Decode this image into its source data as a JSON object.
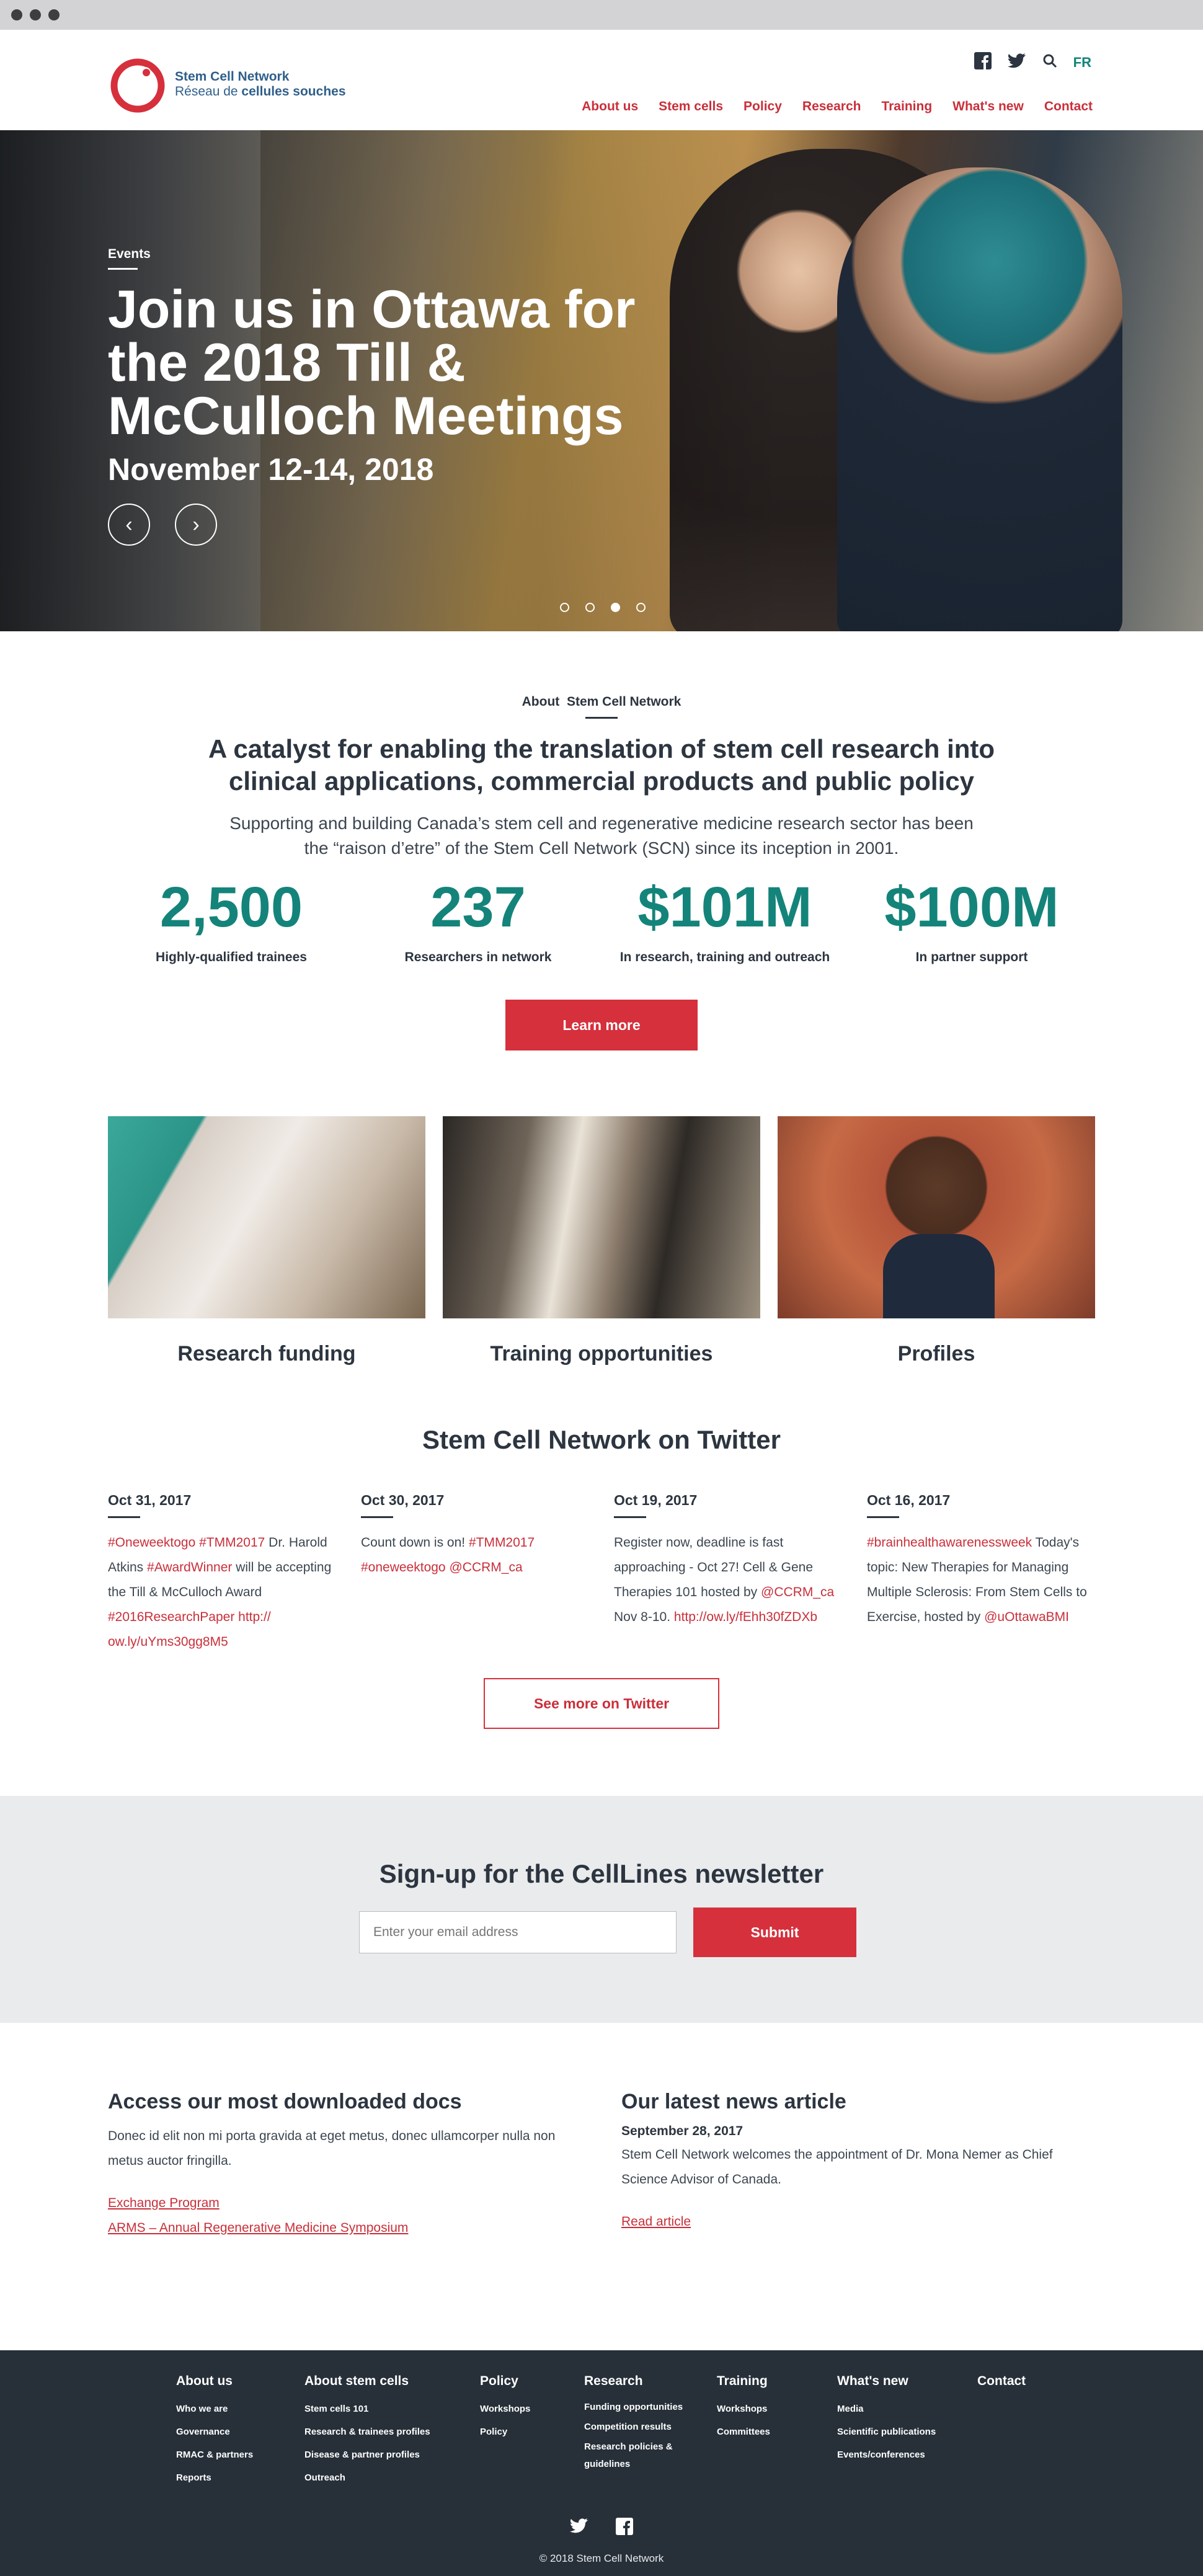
{
  "brand": {
    "name_en": "Stem Cell Network",
    "name_fr_prefix": "Réseau de ",
    "name_fr_bold": "cellules souches",
    "accent": "#c92f3a",
    "teal": "#14847a",
    "dark": "#273039"
  },
  "utility": {
    "lang": "FR"
  },
  "nav": {
    "items": [
      "About us",
      "Stem cells",
      "Policy",
      "Research",
      "Training",
      "What's new",
      "Contact"
    ]
  },
  "hero": {
    "tag": "Events",
    "title": "Join us in Ottawa for the 2018 Till & McCulloch Meetings",
    "date": "November 12-14, 2018",
    "prev": "‹",
    "next": "›",
    "active_slide": 3,
    "slide_count": 4
  },
  "about": {
    "eyebrow_a": "About",
    "eyebrow_b": "Stem Cell Network",
    "heading": "A catalyst for enabling the translation of stem cell research into clinical applications, commercial products and public policy",
    "body": "Supporting and building Canada’s stem cell and regenerative medicine research sector has been the “raison d’etre” of the Stem Cell Network (SCN) since its inception in 2001.",
    "stats": [
      {
        "value": "2,500",
        "label": "Highly-qualified trainees"
      },
      {
        "value": "237",
        "label": "Researchers in network"
      },
      {
        "value": "$101M",
        "label": "In research, training and outreach"
      },
      {
        "value": "$100M",
        "label": "In partner support"
      }
    ],
    "cta": "Learn more"
  },
  "cards": [
    {
      "title": "Research funding"
    },
    {
      "title": "Training opportunities"
    },
    {
      "title": "Profiles"
    }
  ],
  "twitter": {
    "heading": "Stem Cell Network on Twitter",
    "button": "See more on Twitter",
    "tweets": [
      {
        "date": "Oct 31, 2017",
        "parts": [
          [
            "h",
            "#Oneweektogo"
          ],
          [
            "t",
            " "
          ],
          [
            "h",
            "#TMM2017"
          ],
          [
            "t",
            " Dr. Harold Atkins "
          ],
          [
            "h",
            "#AwardWinner"
          ],
          [
            "t",
            " will be accepting the Till & McCulloch Award "
          ],
          [
            "h",
            "#2016ResearchPaper"
          ],
          [
            "t",
            " "
          ],
          [
            "h",
            "http:// ow.ly/uYms30gg8M5"
          ]
        ]
      },
      {
        "date": "Oct 30, 2017",
        "parts": [
          [
            "t",
            "Count down is on! "
          ],
          [
            "h",
            "#TMM2017"
          ],
          [
            "t",
            " "
          ],
          [
            "h",
            "#oneweektogo"
          ],
          [
            "t",
            " "
          ],
          [
            "h",
            "@CCRM_ca"
          ]
        ]
      },
      {
        "date": "Oct 19, 2017",
        "parts": [
          [
            "t",
            "Register now, deadline is fast approaching - Oct 27! Cell & Gene Therapies 101 hosted by "
          ],
          [
            "h",
            "@CCRM_ca"
          ],
          [
            "t",
            " Nov 8-10. "
          ],
          [
            "h",
            "http://ow.ly/fEhh30fZDXb"
          ]
        ]
      },
      {
        "date": "Oct 16, 2017",
        "parts": [
          [
            "h",
            "#brainhealthawarenessweek"
          ],
          [
            "t",
            " Today's topic: New Therapies for Managing Multiple Sclerosis: From Stem Cells to Exercise, hosted by "
          ],
          [
            "h",
            "@uOttawaBMI"
          ]
        ]
      }
    ]
  },
  "newsletter": {
    "heading": "Sign-up for the CellLines newsletter",
    "placeholder": "Enter your email address",
    "submit": "Submit"
  },
  "docs": {
    "heading": "Access our most downloaded docs",
    "body": "Donec id elit non mi porta gravida at eget metus, donec ullamcorper nulla non metus auctor fringilla.",
    "links": [
      "Exchange Program",
      "ARMS – Annual Regenerative Medicine Symposium"
    ]
  },
  "article": {
    "heading": "Our latest news article",
    "date": "September 28, 2017",
    "body": "Stem Cell Network welcomes the appointment of Dr. Mona Nemer as Chief Science Advisor of Canada.",
    "link": "Read article"
  },
  "footer": {
    "columns": [
      {
        "title": "About us",
        "links": [
          "Who we are",
          "Governance",
          "RMAC & partners",
          "Reports"
        ]
      },
      {
        "title": "About stem cells",
        "links": [
          "Stem cells 101",
          "Research & trainees profiles",
          "Disease & partner profiles",
          "Outreach"
        ]
      },
      {
        "title": "Policy",
        "links": [
          "Workshops",
          "Policy"
        ]
      },
      {
        "title": "Research",
        "links": [
          "Funding opportunities",
          "Competition results",
          "Research policies & guidelines"
        ]
      },
      {
        "title": "Training",
        "links": [
          "Workshops",
          "Committees"
        ]
      },
      {
        "title": "What's new",
        "links": [
          "Media",
          "Scientific publications",
          "Events/conferences"
        ]
      },
      {
        "title": "Contact",
        "links": []
      }
    ],
    "copyright": "© 2018 Stem Cell Network"
  },
  "icons": [
    "facebook-icon",
    "twitter-icon",
    "search-icon"
  ]
}
